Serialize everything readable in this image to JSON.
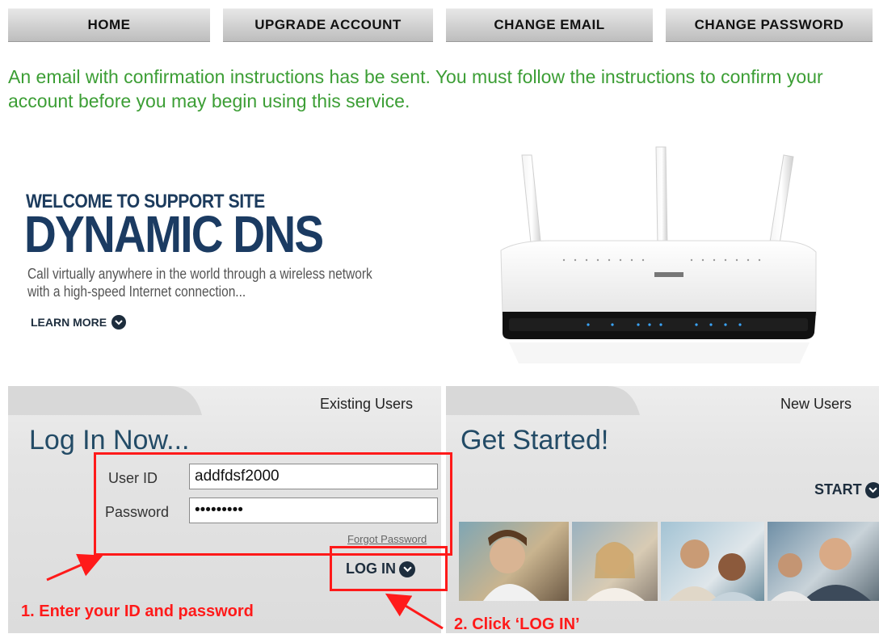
{
  "nav": {
    "home": "HOME",
    "upgrade": "UPGRADE ACCOUNT",
    "change_email": "CHANGE EMAIL",
    "change_password": "CHANGE PASSWORD"
  },
  "message": "An email with confirmation instructions has be sent. You must follow the instructions to confirm your account before you may begin using this service.",
  "hero": {
    "small_title": "WELCOME TO SUPPORT SITE",
    "big_title": "DYNAMIC DNS",
    "description": "Call virtually anywhere in the world through a wireless network with a high-speed Internet connection...",
    "learn_more": "LEARN MORE"
  },
  "login": {
    "tab_label": "Existing Users",
    "title": "Log In Now...",
    "user_label": "User ID",
    "user_value": "addfdsf2000",
    "password_label": "Password",
    "password_value": "addfdsf20",
    "forgot": "Forgot Password",
    "button": "LOG IN"
  },
  "signup": {
    "tab_label": "New Users",
    "title": "Get Started!",
    "button": "START"
  },
  "annotations": {
    "step1": "1.   Enter your ID and password",
    "step2": "2. Click ‘LOG IN’"
  },
  "colors": {
    "message_green": "#3c9e35",
    "title_navy": "#1b3b62",
    "annotation_red": "#ff1a1a"
  },
  "icons": {
    "learn_more": "chevron-down-circle-icon",
    "login": "chevron-down-circle-icon",
    "start": "chevron-down-circle-icon"
  }
}
